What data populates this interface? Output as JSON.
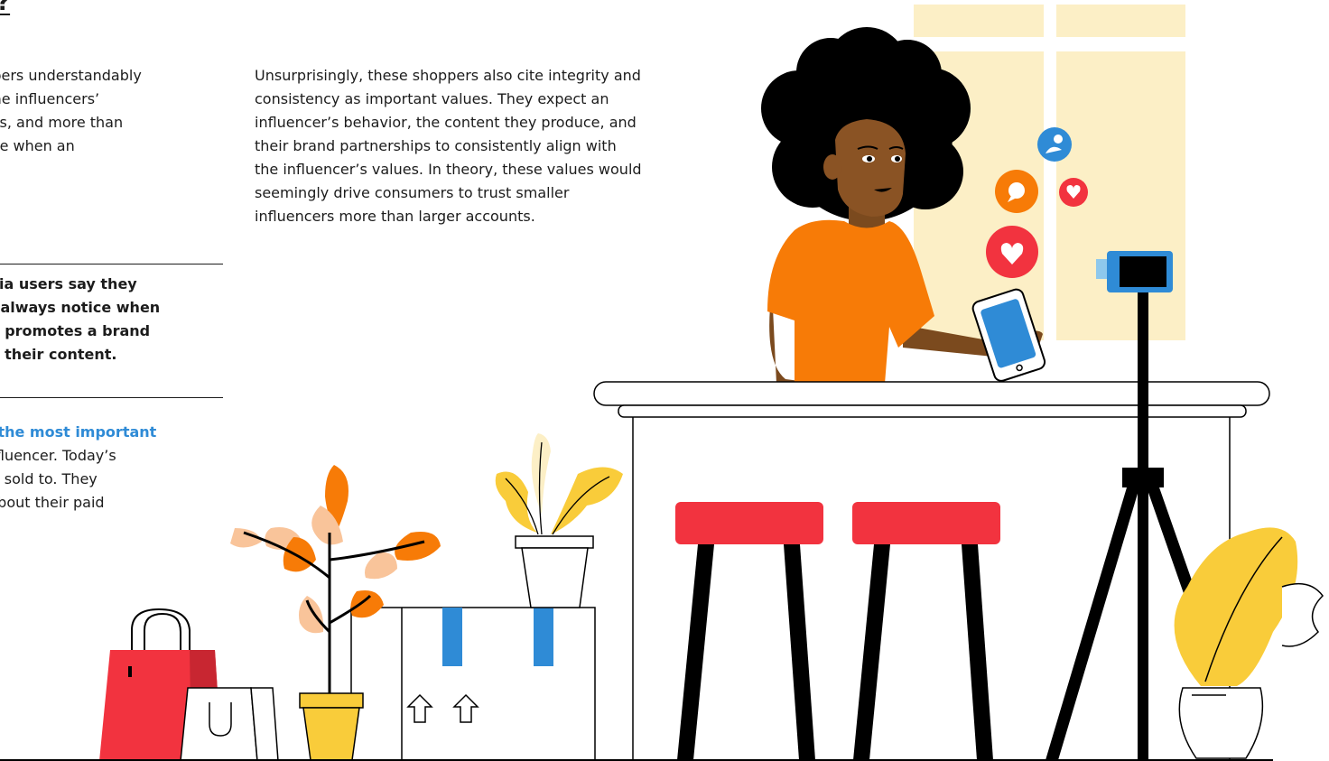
{
  "heading": "?",
  "left_paragraph": "e shoppers understandably\n know the influencers’\n products, and more than\necognize when an\nst.",
  "right_paragraph": "Unsurprisingly, these shoppers also cite integrity and\nconsistency as important values. They expect an\ninfluencer’s behavior, the content they produce, and\ntheir brand partnerships to consistently align with\nthe influencer’s values. In theory, these values would\nseemingly drive consumers to trust smaller\ninfluencers more than larger accounts.",
  "stat_callout": "media users say they\ny or always notice when\nncer promotes a brand\nct in their content.",
  "tip": {
    "highlight": "ncy is the most important",
    "rest": "\ng an influencer. Today’s\ne being sold to. They\narent about their paid"
  },
  "colors": {
    "accent_blue": "#2f8bd6",
    "stool_red": "#f2333f",
    "shirt_orange": "#f77b07",
    "window_cream": "#fcefc6",
    "plant_yellow": "#f9cc3a"
  },
  "icons": [
    "user-icon",
    "chat-icon",
    "heart-icon"
  ]
}
